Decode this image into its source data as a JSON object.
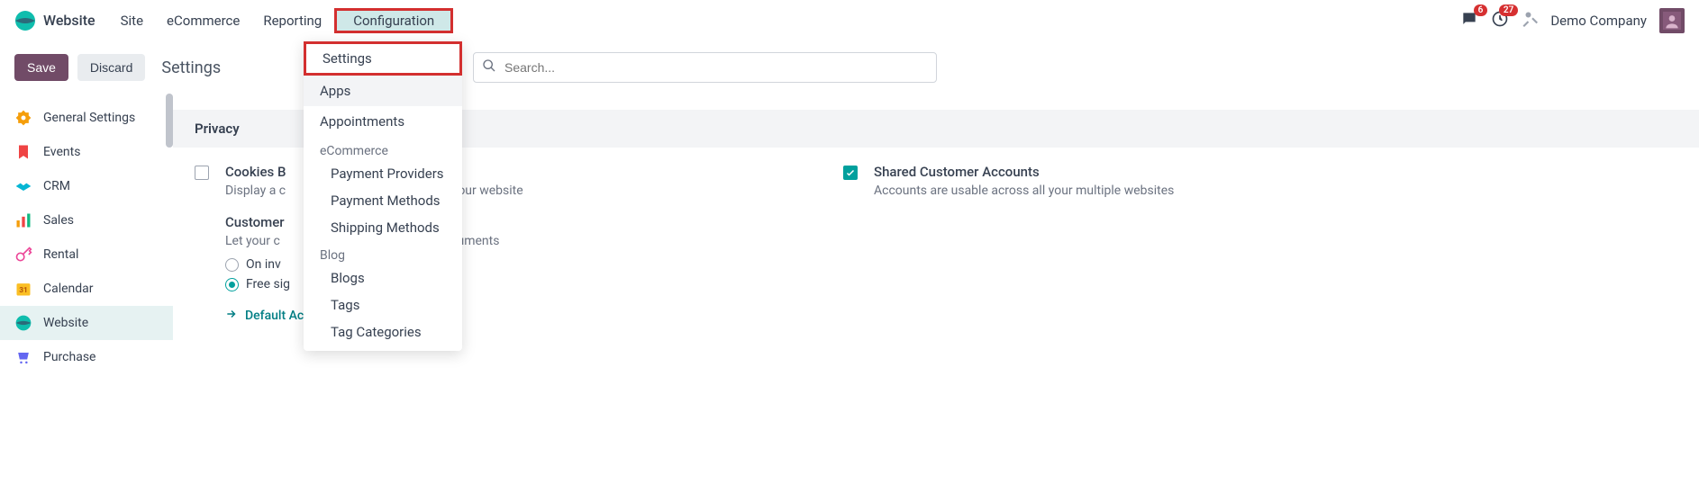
{
  "brand": {
    "name": "Website"
  },
  "nav": {
    "items": [
      {
        "label": "Site"
      },
      {
        "label": "eCommerce"
      },
      {
        "label": "Reporting"
      },
      {
        "label": "Configuration",
        "highlighted": true
      }
    ]
  },
  "topright": {
    "messages_badge": "6",
    "activities_badge": "27",
    "company": "Demo Company"
  },
  "controlbar": {
    "save": "Save",
    "discard": "Discard",
    "title": "Settings"
  },
  "search": {
    "placeholder": "Search..."
  },
  "sidebar": {
    "items": [
      {
        "label": "General Settings"
      },
      {
        "label": "Events"
      },
      {
        "label": "CRM"
      },
      {
        "label": "Sales"
      },
      {
        "label": "Rental"
      },
      {
        "label": "Calendar"
      },
      {
        "label": "Website",
        "active": true
      },
      {
        "label": "Purchase"
      }
    ]
  },
  "section": {
    "privacy": "Privacy"
  },
  "settings": {
    "cookies": {
      "title": "Cookies B",
      "desc": "Display a c",
      "desc_tail": "n your website"
    },
    "customer": {
      "title": "Customer",
      "desc": "Let your c",
      "desc_tail": "documents"
    },
    "radios": {
      "on_inv": "On inv",
      "free_sign": "Free sig"
    },
    "link": "Default Access Rights",
    "shared": {
      "title": "Shared Customer Accounts",
      "desc": "Accounts are usable across all your multiple websites"
    }
  },
  "dropdown": {
    "settings": "Settings",
    "apps": "Apps",
    "appointments": "Appointments",
    "ecommerce_section": "eCommerce",
    "payment_providers": "Payment Providers",
    "payment_methods": "Payment Methods",
    "shipping_methods": "Shipping Methods",
    "blog_section": "Blog",
    "blogs": "Blogs",
    "tags": "Tags",
    "tag_categories": "Tag Categories"
  }
}
